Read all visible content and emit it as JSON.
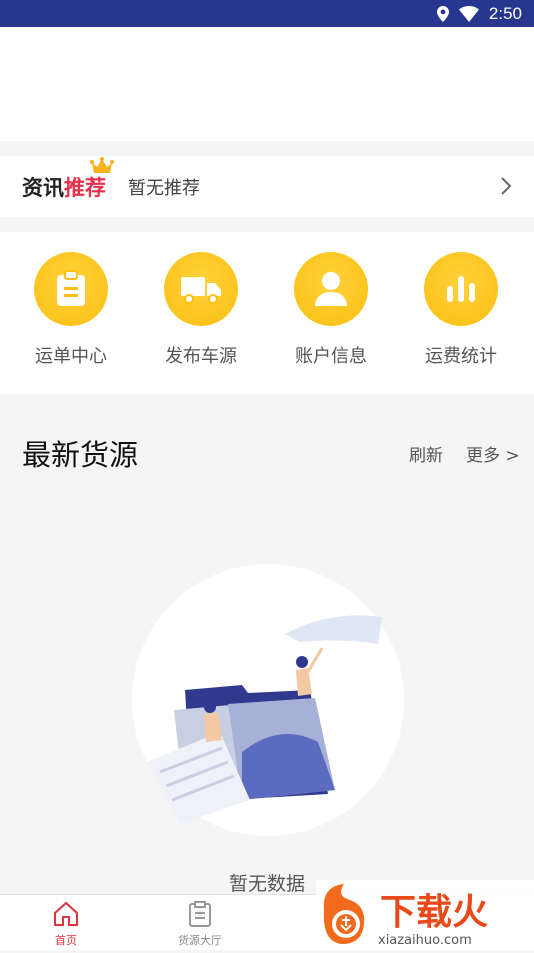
{
  "status_bar": {
    "time": "2:50"
  },
  "news": {
    "logo_part1": "资讯",
    "logo_part2": "推荐",
    "text": "暂无推荐"
  },
  "menu": [
    {
      "label": "运单中心",
      "icon": "clipboard-icon"
    },
    {
      "label": "发布车源",
      "icon": "truck-icon"
    },
    {
      "label": "账户信息",
      "icon": "user-icon"
    },
    {
      "label": "运费统计",
      "icon": "bar-chart-icon"
    }
  ],
  "section": {
    "title": "最新货源",
    "refresh": "刷新",
    "more": "更多 >"
  },
  "empty": {
    "text": "暂无数据"
  },
  "tabs": [
    {
      "label": "首页",
      "active": true
    },
    {
      "label": "货源大厅",
      "active": false
    }
  ],
  "watermark": {
    "brand": "下载火",
    "url": "xiazaihuo.com"
  },
  "colors": {
    "accent": "#d9363e",
    "status_bar": "#27378f",
    "icon_bg": "#fbc11b"
  }
}
